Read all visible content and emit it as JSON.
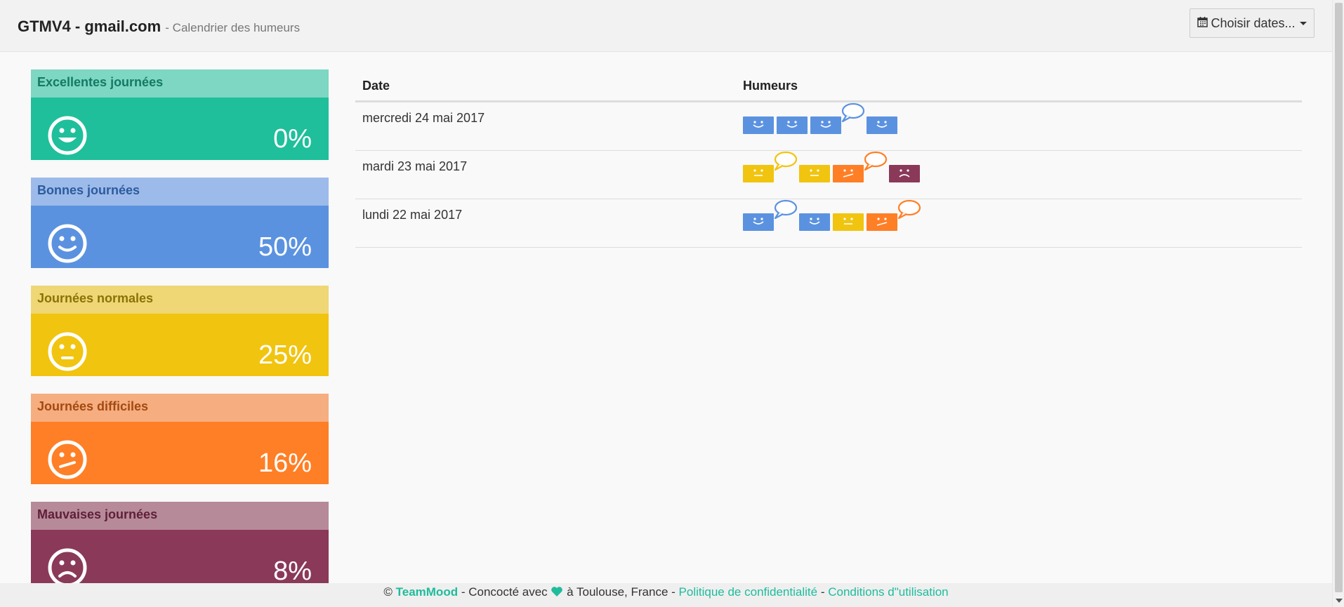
{
  "header": {
    "title": "GTMV4 - gmail.com",
    "subtitle": "- Calendrier des humeurs",
    "choose_dates_label": "Choisir dates...",
    "calendar_icon": "calendar-icon"
  },
  "colors": {
    "excellent": "#1fbf9b",
    "bonne": "#5b92e0",
    "normale": "#f1c40f",
    "difficile": "#ff7f26",
    "mauvaise": "#8a3959",
    "teal": "#1fbc9c"
  },
  "cards": [
    {
      "label": "Excellentes journées",
      "percent": "0%",
      "icon": "big-smile-icon"
    },
    {
      "label": "Bonnes journées",
      "percent": "50%",
      "icon": "smile-icon"
    },
    {
      "label": "Journées normales",
      "percent": "25%",
      "icon": "neutral-face-icon"
    },
    {
      "label": "Journées difficiles",
      "percent": "16%",
      "icon": "skeptical-face-icon"
    },
    {
      "label": "Mauvaises journées",
      "percent": "8%",
      "icon": "sad-face-icon"
    }
  ],
  "table": {
    "col_date": "Date",
    "col_moods": "Humeurs",
    "rows": [
      {
        "date": "mercredi 24 mai 2017",
        "moods": [
          {
            "level": "bonne",
            "comment": false
          },
          {
            "level": "bonne",
            "comment": false
          },
          {
            "level": "bonne",
            "comment": true
          },
          {
            "level": "bonne",
            "comment": false
          }
        ]
      },
      {
        "date": "mardi 23 mai 2017",
        "moods": [
          {
            "level": "normale",
            "comment": true
          },
          {
            "level": "normale",
            "comment": false
          },
          {
            "level": "difficile",
            "comment": true
          },
          {
            "level": "mauvaise",
            "comment": false
          }
        ]
      },
      {
        "date": "lundi 22 mai 2017",
        "moods": [
          {
            "level": "bonne",
            "comment": true
          },
          {
            "level": "bonne",
            "comment": false
          },
          {
            "level": "normale",
            "comment": false
          },
          {
            "level": "difficile",
            "comment": true
          }
        ]
      }
    ]
  },
  "footer": {
    "copyright": "©",
    "brand": "TeamMood",
    "made_with": "- Concocté avec",
    "location": "à Toulouse, France -",
    "privacy": "Politique de confidentialité",
    "separator": "-",
    "terms": "Conditions d\"utilisation",
    "heart_icon": "heart-icon"
  }
}
